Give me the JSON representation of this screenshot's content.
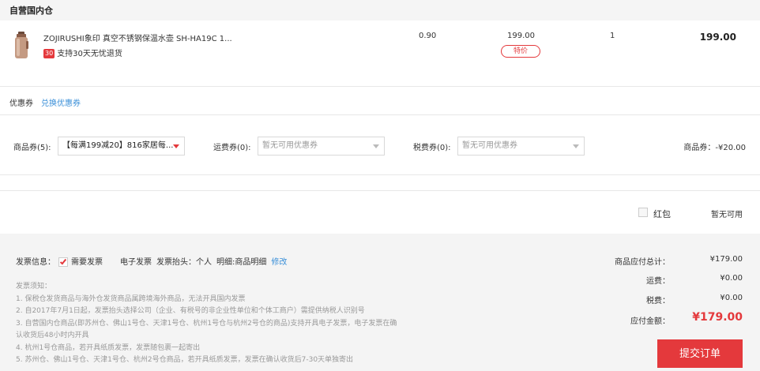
{
  "warehouse": {
    "title": "自营国内仓"
  },
  "product": {
    "name": "ZOJIRUSHI象印 真空不锈钢保温水壶 SH-HA19C 1...",
    "service_badge": "30",
    "service_text": "支持30天无忧退货",
    "weight": "0.90",
    "price": "199.00",
    "price_tag": "特价",
    "quantity": "1",
    "subtotal": "199.00"
  },
  "coupon": {
    "title": "优惠券",
    "exchange_link": "兑换优惠券",
    "goods_label": "商品券(5):",
    "goods_value": "【每满199减20】816家居每...",
    "freight_label": "运费券(0):",
    "freight_value": "暂无可用优惠券",
    "tax_label": "税费券(0):",
    "tax_value": "暂无可用优惠券",
    "goods_total": "商品券：-¥20.00"
  },
  "hongbao": {
    "label": "红包",
    "status": "暂无可用"
  },
  "invoice": {
    "label": "发票信息：",
    "need_label": "需要发票",
    "type": "电子发票",
    "header": "发票抬头：个人",
    "detail": "明细:商品明细",
    "edit_link": "修改"
  },
  "notes": [
    "发票须知：",
    "1. 保税仓发货商品与海外仓发货商品属跨境海外商品，无法开具国内发票",
    "2. 自2017年7月1日起，发票抬头选择公司（企业、有税号的非企业性单位和个体工商户）需提供纳税人识别号",
    "3. 自营国内仓商品(即苏州仓、佛山1号仓、天津1号仓、杭州1号仓与杭州2号仓的商品)支持开具电子发票，电子发票在确",
    "认收货后48小时内开具",
    "4. 杭州1号仓商品，若开具纸质发票，发票随包裹一起寄出",
    "5. 苏州仓、佛山1号仓、天津1号仓、杭州2号仓商品，若开具纸质发票，发票在确认收货后7-30天单独寄出"
  ],
  "summary": {
    "goods_label": "商品应付总计：",
    "goods_value": "¥179.00",
    "freight_label": "运费：",
    "freight_value": "¥0.00",
    "tax_label": "税费：",
    "tax_value": "¥0.00",
    "total_label": "应付金额：",
    "total_value": "¥179.00",
    "submit_label": "提交订单"
  },
  "colors": {
    "accent": "#e4393c",
    "link": "#3a8fd8"
  }
}
